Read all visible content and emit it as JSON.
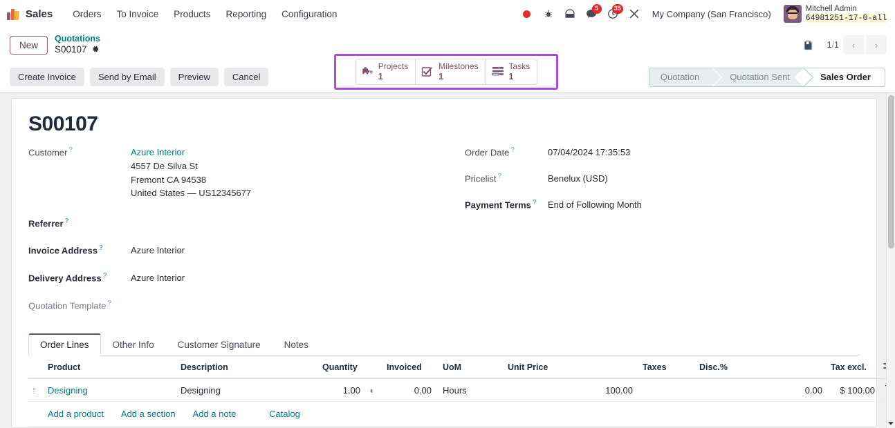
{
  "navbar": {
    "app_name": "Sales",
    "menus": [
      {
        "label": "Orders"
      },
      {
        "label": "To Invoice"
      },
      {
        "label": "Products"
      },
      {
        "label": "Reporting"
      },
      {
        "label": "Configuration"
      }
    ],
    "systray": {
      "recording_icon": "record-dot-icon",
      "bug_icon": "bug-icon",
      "voip_icon": "phone-icon",
      "messages_icon": "messages-icon",
      "messages_count": "5",
      "activities_icon": "clock-icon",
      "activities_count": "35",
      "debug_icon": "wrench-icon",
      "company": "My Company (San Francisco)",
      "user_name": "Mitchell Admin",
      "user_db": "64981251-17-0-all"
    }
  },
  "control_panel": {
    "new_button": "New",
    "breadcrumb_parent": "Quotations",
    "breadcrumb_current": "S00107",
    "gear_icon": "gear-icon",
    "attachment_icon": "attachment-icon",
    "pager": {
      "current": "1",
      "separator": "/",
      "total": "1",
      "prev_icon": "chevron-left-icon",
      "next_icon": "chevron-right-icon"
    },
    "smart_buttons": [
      {
        "label": "Projects",
        "value": "1",
        "icon": "puzzle-piece-icon"
      },
      {
        "label": "Milestones",
        "value": "1",
        "icon": "check-square-icon"
      },
      {
        "label": "Tasks",
        "value": "1",
        "icon": "tasks-icon"
      }
    ],
    "highlight_color": "#a64ce0",
    "action_buttons": [
      {
        "label": "Create Invoice"
      },
      {
        "label": "Send by Email"
      },
      {
        "label": "Preview"
      },
      {
        "label": "Cancel"
      }
    ],
    "statusbar": [
      {
        "label": "Quotation",
        "active": false
      },
      {
        "label": "Quotation Sent",
        "active": false
      },
      {
        "label": "Sales Order",
        "active": true
      }
    ]
  },
  "record": {
    "title": "S00107",
    "left_fields": [
      {
        "label": "Customer",
        "bold": false,
        "help": "?",
        "link": "Azure Interior",
        "lines": [
          "4557 De Silva St",
          "Fremont CA 94538",
          "United States — US12345677"
        ]
      },
      {
        "label": "Referrer",
        "bold": true,
        "help": "?",
        "value": ""
      },
      {
        "label": "Invoice Address",
        "bold": true,
        "help": "?",
        "value": "Azure Interior"
      },
      {
        "label": "Delivery Address",
        "bold": true,
        "help": "?",
        "value": "Azure Interior"
      },
      {
        "label": "Quotation Template",
        "bold": false,
        "help": "?",
        "value": ""
      }
    ],
    "right_fields": [
      {
        "label": "Order Date",
        "bold": false,
        "help": "?",
        "value": "07/04/2024 17:35:53"
      },
      {
        "label": "Pricelist",
        "bold": false,
        "help": "?",
        "value": "Benelux (USD)"
      },
      {
        "label": "Payment Terms",
        "bold": true,
        "help": "?",
        "value": "End of Following Month"
      }
    ]
  },
  "notebook": {
    "tabs": [
      {
        "label": "Order Lines",
        "active": true
      },
      {
        "label": "Other Info",
        "active": false
      },
      {
        "label": "Customer Signature",
        "active": false
      },
      {
        "label": "Notes",
        "active": false
      }
    ]
  },
  "order_lines": {
    "columns": [
      {
        "label": "Product"
      },
      {
        "label": "Description"
      },
      {
        "label": "Quantity"
      },
      {
        "label": "Invoiced"
      },
      {
        "label": "UoM"
      },
      {
        "label": "Unit Price"
      },
      {
        "label": "Taxes"
      },
      {
        "label": "Disc.%"
      },
      {
        "label": "Tax excl."
      }
    ],
    "optional_columns_icon": "column-options-icon",
    "rows": [
      {
        "drag_handle": "⣿",
        "product": "Designing",
        "description": "Designing",
        "quantity": "1.00",
        "quantity_extra_icon": "clipped-indicator-icon",
        "invoiced": "0.00",
        "uom": "Hours",
        "unit_price": "100.00",
        "taxes": "",
        "discount": "0.00",
        "tax_excl": "$ 100.00",
        "delete_icon": "trash-icon"
      }
    ],
    "add_links": [
      {
        "label": "Add a product"
      },
      {
        "label": "Add a section"
      },
      {
        "label": "Add a note"
      },
      {
        "label": "Catalog"
      }
    ]
  }
}
